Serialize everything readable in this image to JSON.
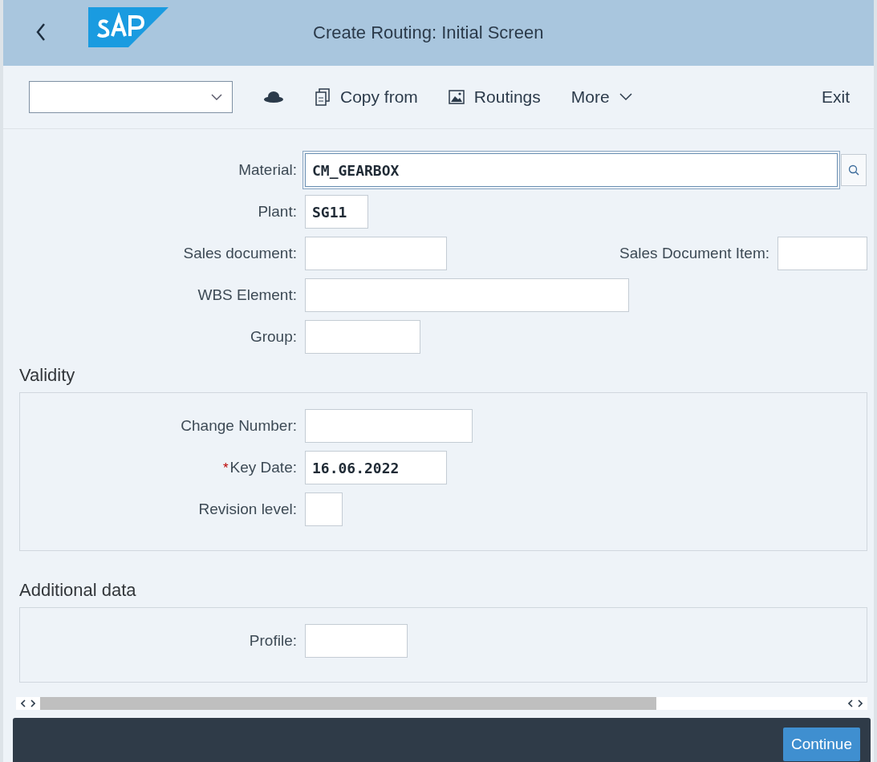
{
  "window": {
    "title": "Create Routing: Initial Screen"
  },
  "toolbar": {
    "items": [
      {
        "kind": "icon"
      },
      {
        "kind": "copy",
        "label": "Copy from"
      },
      {
        "kind": "image",
        "label": "Routings"
      },
      {
        "kind": "more",
        "label": "More"
      }
    ],
    "exit": "Exit"
  },
  "fields": [
    {
      "label": "Material:",
      "value": "CM_GEARBOX",
      "focused": true
    },
    {
      "label": "Plant:",
      "value": "SG11"
    },
    {
      "label": "Sales document:",
      "side": {
        "label": "Sales Document Item:"
      }
    },
    {
      "label": "WBS Element:"
    },
    {
      "label": "Group:"
    }
  ],
  "sections": [
    {
      "title": "Validity",
      "fields": [
        {
          "label": "Change Number:"
        },
        {
          "label": "Key Date:",
          "value": "16.06.2022",
          "marker": "*"
        },
        {
          "label": "Revision level:"
        }
      ]
    },
    {
      "title": "Additional data",
      "fields": [
        {
          "label": "Profile:"
        }
      ]
    }
  ],
  "footer": {
    "button": "Continue"
  }
}
